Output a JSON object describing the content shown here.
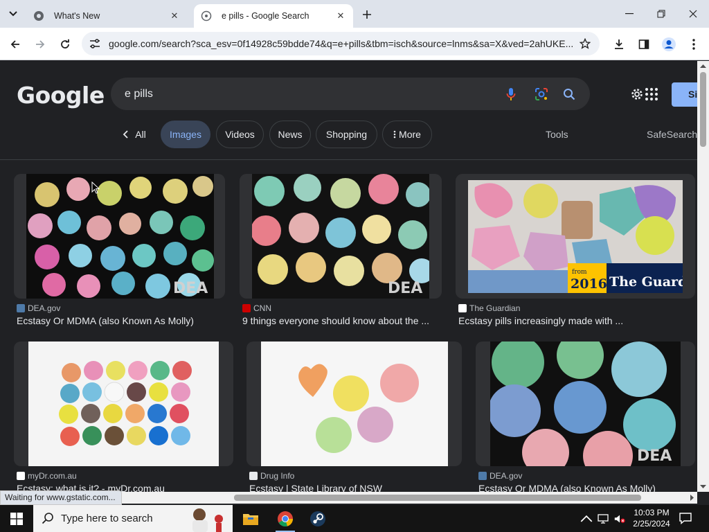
{
  "browser": {
    "tabs": [
      {
        "title": "What's New",
        "active": false
      },
      {
        "title": "e pills - Google Search",
        "active": true
      }
    ],
    "url": "google.com/search?sca_esv=0f14928c59bdde74&q=e+pills&tbm=isch&source=lnms&sa=X&ved=2ahUKE...",
    "status_text": "Waiting for www.gstatic.com..."
  },
  "google": {
    "logo": "Google",
    "query": "e pills",
    "sign_in_label": "Si",
    "chips": {
      "all": "All",
      "images": "Images",
      "videos": "Videos",
      "news": "News",
      "shopping": "Shopping",
      "more": "More"
    },
    "tools_label": "Tools",
    "safesearch_label": "SafeSearch"
  },
  "results": [
    {
      "source": "DEA.gov",
      "caption": "Ecstasy Or MDMA (also Known As Molly)",
      "favicon_color": "#4e7aa8"
    },
    {
      "source": "CNN",
      "caption": "9 things everyone should know about the ...",
      "favicon_color": "#cc0000"
    },
    {
      "source": "The Guardian",
      "caption": "Ecstasy pills increasingly made with ...",
      "favicon_color": "#ffffff",
      "overlay": {
        "year": "2016",
        "from": "from",
        "brand": "The Guardian"
      }
    },
    {
      "source": "myDr.com.au",
      "caption": "Ecstasy: what is it? - myDr.com.au",
      "favicon_color": "#ffffff"
    },
    {
      "source": "Drug Info",
      "caption": "Ecstasy | State Library of NSW",
      "favicon_color": "#e8eaed"
    },
    {
      "source": "DEA.gov",
      "caption": "Ecstasy Or MDMA (also Known As Molly)",
      "favicon_color": "#4e7aa8"
    }
  ],
  "taskbar": {
    "search_placeholder": "Type here to search",
    "time": "10:03 PM",
    "date": "2/25/2024"
  }
}
